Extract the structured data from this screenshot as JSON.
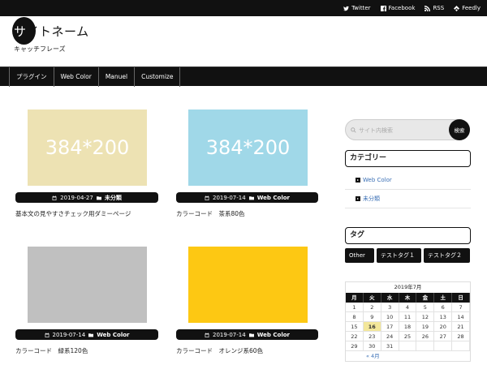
{
  "topbar": {
    "links": [
      {
        "label": "Twitter",
        "icon": "twitter-icon"
      },
      {
        "label": "Facebook",
        "icon": "facebook-icon"
      },
      {
        "label": "RSS",
        "icon": "rss-icon"
      },
      {
        "label": "Feedly",
        "icon": "feedly-icon"
      }
    ]
  },
  "header": {
    "site_name_first": "サ",
    "site_name_rest": "イトネーム",
    "tagline": "キャッチフレーズ"
  },
  "nav": {
    "items": [
      "プラグイン",
      "Web Color",
      "Manuel",
      "Customize"
    ]
  },
  "posts": [
    {
      "thumb_text": "384*200",
      "thumb_color": "#ede2b3",
      "date": "2019-04-27",
      "category": "未分類",
      "title": "基本文の見やすさチェック用ダミーページ"
    },
    {
      "thumb_text": "384*200",
      "thumb_color": "#a0d8e8",
      "date": "2019-07-14",
      "category": "Web Color",
      "title": "カラーコード　茶系80色"
    },
    {
      "thumb_text": "",
      "thumb_color": "#c0c0c0",
      "date": "2019-07-14",
      "category": "Web Color",
      "title": "カラーコード　緑系120色"
    },
    {
      "thumb_text": "",
      "thumb_color": "#fdc813",
      "date": "2019-07-14",
      "category": "Web Color",
      "title": "カラーコード　オレンジ系60色"
    }
  ],
  "sidebar": {
    "search": {
      "placeholder": "サイト内検索",
      "button": "検索"
    },
    "categories": {
      "title": "カテゴリー",
      "items": [
        "Web Color",
        "未分類"
      ]
    },
    "tags": {
      "title": "タグ",
      "items": [
        "Other",
        "テストタグ１",
        "テストタグ２"
      ]
    },
    "calendar": {
      "caption": "2019年7月",
      "headers": [
        "月",
        "火",
        "水",
        "木",
        "金",
        "土",
        "日"
      ],
      "days": [
        "1",
        "2",
        "3",
        "4",
        "5",
        "6",
        "7",
        "8",
        "9",
        "10",
        "11",
        "12",
        "13",
        "14",
        "15",
        "16",
        "17",
        "18",
        "19",
        "20",
        "21",
        "22",
        "23",
        "24",
        "25",
        "26",
        "27",
        "28",
        "29",
        "30",
        "31"
      ],
      "today": "16",
      "prev": "« 4月"
    }
  },
  "colors": {
    "dark": "#111111",
    "link": "#3a6fb5",
    "today": "#f3e79a"
  }
}
